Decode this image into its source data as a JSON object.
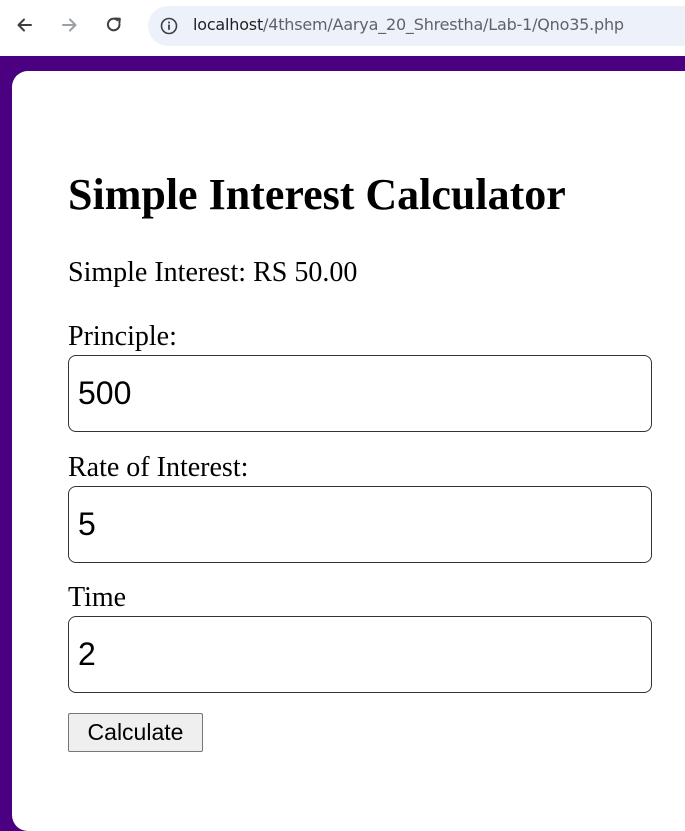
{
  "browser": {
    "url_host": "localhost",
    "url_path": "/4thsem/Aarya_20_Shrestha/Lab-1/Qno35.php",
    "icons": {
      "back": "back-arrow-icon",
      "forward": "forward-arrow-icon",
      "reload": "reload-icon",
      "site_info": "info-icon"
    }
  },
  "page": {
    "title": "Simple Interest Calculator",
    "result_text": "Simple Interest: RS 50.00",
    "fields": [
      {
        "label": "Principle:",
        "value": "500"
      },
      {
        "label": "Rate of Interest:",
        "value": "5"
      },
      {
        "label": "Time",
        "value": "2"
      }
    ],
    "submit_label": "Calculate"
  },
  "colors": {
    "page_background": "#4b0082",
    "card_background": "#ffffff",
    "address_bar": "#edf2fa"
  }
}
